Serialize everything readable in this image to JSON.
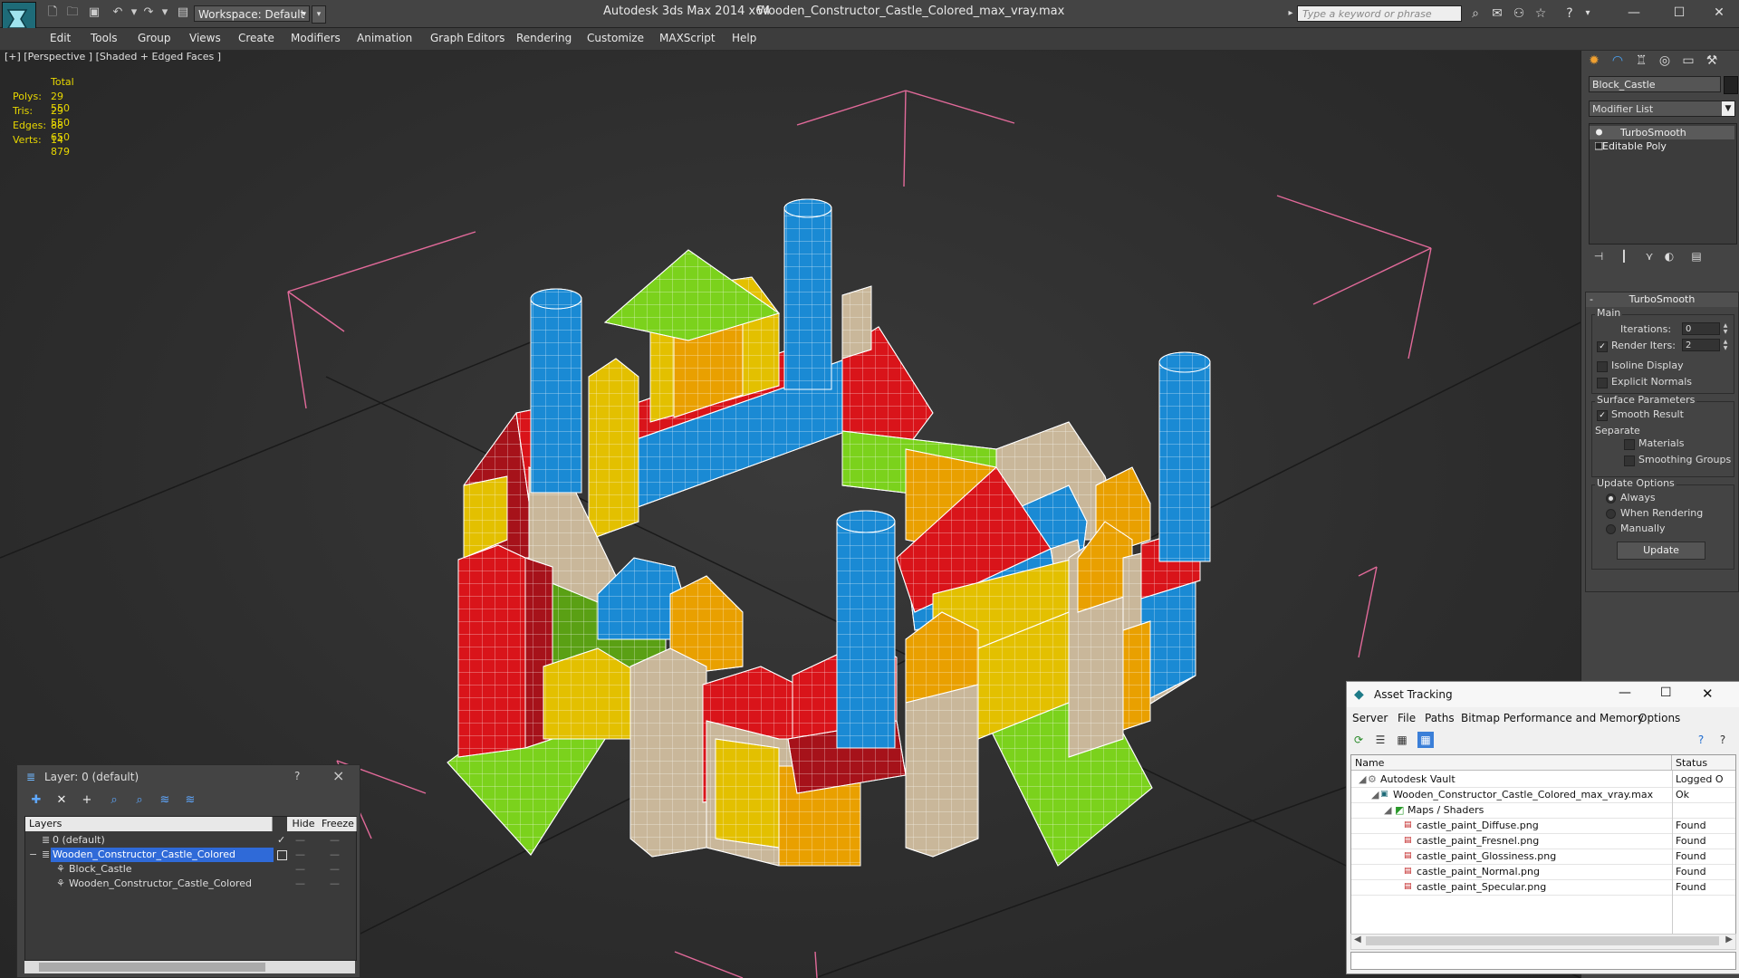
{
  "title_bar": {
    "app_title": "Autodesk 3ds Max  2014 x64",
    "file_title": "Wooden_Constructor_Castle_Colored_max_vray.max",
    "workspace": "Workspace: Default",
    "search_placeholder": "Type a keyword or phrase"
  },
  "menu": [
    "Edit",
    "Tools",
    "Group",
    "Views",
    "Create",
    "Modifiers",
    "Animation",
    "Graph Editors",
    "Rendering",
    "Customize",
    "MAXScript",
    "Help"
  ],
  "viewport": {
    "label": "[+] [Perspective ] [Shaded + Edged Faces ]",
    "stats": {
      "header": "Total",
      "rows": [
        {
          "k": "Polys:",
          "v": "29 550"
        },
        {
          "k": "Tris:",
          "v": "29 550"
        },
        {
          "k": "Edges:",
          "v": "88 650"
        },
        {
          "k": "Verts:",
          "v": "14 879"
        }
      ]
    }
  },
  "command_panel": {
    "object_name": "Block_Castle",
    "modifier_list": "Modifier List",
    "stack": [
      "TurboSmooth",
      "Editable Poly"
    ],
    "rollout_title": "TurboSmooth",
    "main_label": "Main",
    "iterations_label": "Iterations:",
    "iterations_value": "0",
    "render_iters_label": "Render Iters:",
    "render_iters_value": "2",
    "isoline_label": "Isoline Display",
    "explicit_normals_label": "Explicit Normals",
    "surface_label": "Surface Parameters",
    "smooth_result_label": "Smooth Result",
    "separate_label": "Separate",
    "materials_label": "Materials",
    "smoothing_groups_label": "Smoothing Groups",
    "update_options_label": "Update Options",
    "always_label": "Always",
    "when_rendering_label": "When Rendering",
    "manually_label": "Manually",
    "update_button": "Update"
  },
  "layer_window": {
    "title": "Layer: 0 (default)",
    "help": "?",
    "columns": [
      "Layers",
      "Hide",
      "Freeze"
    ],
    "rows": [
      {
        "name": "0 (default)",
        "selected": false
      },
      {
        "name": "Wooden_Constructor_Castle_Colored",
        "selected": true
      },
      {
        "name": "Block_Castle",
        "selected": false
      },
      {
        "name": "Wooden_Constructor_Castle_Colored",
        "selected": false
      }
    ]
  },
  "asset_window": {
    "title": "Asset Tracking",
    "menu": [
      "Server",
      "File",
      "Paths",
      "Bitmap Performance and Memory",
      "Options"
    ],
    "columns": [
      "Name",
      "Status"
    ],
    "rows": [
      {
        "name": "Autodesk Vault",
        "status": "Logged O"
      },
      {
        "name": "Wooden_Constructor_Castle_Colored_max_vray.max",
        "status": "Ok"
      },
      {
        "name": "Maps / Shaders",
        "status": ""
      },
      {
        "name": "castle_paint_Diffuse.png",
        "status": "Found"
      },
      {
        "name": "castle_paint_Fresnel.png",
        "status": "Found"
      },
      {
        "name": "castle_paint_Glossiness.png",
        "status": "Found"
      },
      {
        "name": "castle_paint_Normal.png",
        "status": "Found"
      },
      {
        "name": "castle_paint_Specular.png",
        "status": "Found"
      }
    ]
  },
  "colors": {
    "red": "#d9141a",
    "blue": "#1a8ad4",
    "green": "#7bd21c",
    "yellow": "#e3c000",
    "orange": "#e9a000",
    "beige": "#c9b79a",
    "wire": "#ffffff",
    "bbox": "#e26a9a"
  }
}
